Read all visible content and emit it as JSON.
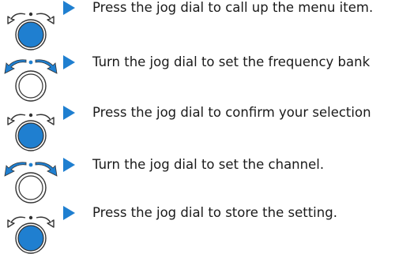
{
  "instructions": [
    {
      "action": "press",
      "text": "Press the jog dial to call up the menu item."
    },
    {
      "action": "turn",
      "text": "Turn the jog dial to set the frequency bank"
    },
    {
      "action": "press",
      "text": "Press the jog dial to confirm your selection"
    },
    {
      "action": "turn",
      "text": "Turn the jog dial to set the channel."
    },
    {
      "action": "press",
      "text": "Press the jog dial to store the setting."
    }
  ],
  "colors": {
    "accent": "#1f7fd0",
    "outline": "#333333"
  }
}
